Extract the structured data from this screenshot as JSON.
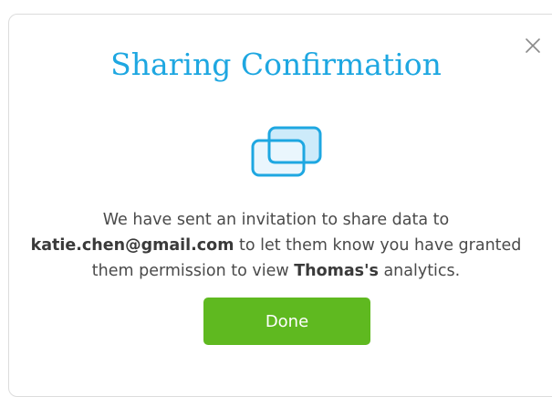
{
  "dialog": {
    "title": "Sharing Confirmation",
    "message": {
      "part1": "We have sent an invitation to share data to",
      "email": "katie.chen@gmail.com",
      "part2": " to let them know you have granted",
      "part3": "them permission to view ",
      "owner": "Thomas's",
      "part4": " analytics."
    },
    "done_label": "Done",
    "close_icon": "close-icon",
    "share_icon": "share-windows-icon"
  },
  "colors": {
    "title": "#1ea7e1",
    "icon_stroke": "#1ea7e1",
    "icon_fill": "#cdebfa",
    "done_button": "#5fb920",
    "close_icon": "#8a8a8a"
  }
}
